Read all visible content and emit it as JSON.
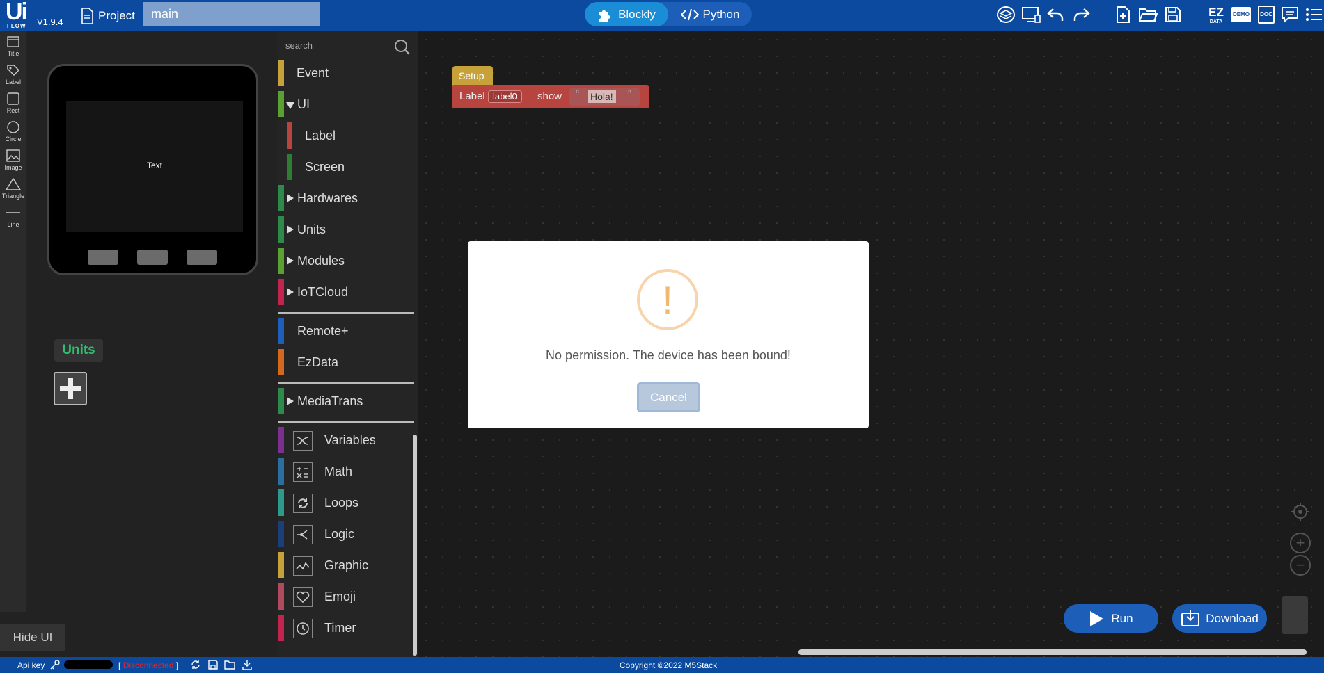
{
  "header": {
    "logo_main": "Ui",
    "logo_sub": "FLOW",
    "version": "V1.9.4",
    "project_label": "Project",
    "file_name": "main",
    "tabs": {
      "blockly": "Blockly",
      "python": "Python"
    },
    "ez_data": {
      "top": "EZ",
      "bottom": "DATA"
    },
    "demo": "DEMO",
    "doc": "DOC"
  },
  "tools": [
    {
      "label": "Title",
      "icon": "title-icon"
    },
    {
      "label": "Label",
      "icon": "label-icon"
    },
    {
      "label": "Rect",
      "icon": "rect-icon"
    },
    {
      "label": "Circle",
      "icon": "circle-icon"
    },
    {
      "label": "Image",
      "icon": "image-icon"
    },
    {
      "label": "Triangle",
      "icon": "triangle-icon"
    },
    {
      "label": "Line",
      "icon": "line-icon"
    }
  ],
  "device": {
    "screen_text": "Text"
  },
  "units_panel": {
    "title": "Units"
  },
  "hide_ui": "Hide UI",
  "categories": {
    "search_placeholder": "search",
    "items": [
      {
        "label": "Event",
        "color": "#c7a23a"
      },
      {
        "label": "UI",
        "color": "#5ba033"
      },
      {
        "label": "Label",
        "color": "#b8443f"
      },
      {
        "label": "Screen",
        "color": "#2e7d32"
      },
      {
        "label": "Hardwares",
        "color": "#2e8a4a"
      },
      {
        "label": "Units",
        "color": "#2e8a4a"
      },
      {
        "label": "Modules",
        "color": "#5ba033"
      },
      {
        "label": "IoTCloud",
        "color": "#c0244f"
      },
      {
        "label": "Remote+",
        "color": "#1d5fb8"
      },
      {
        "label": "EzData",
        "color": "#d2691e"
      },
      {
        "label": "MediaTrans",
        "color": "#2e8a4a"
      },
      {
        "label": "Variables",
        "color": "#7b2f8e"
      },
      {
        "label": "Math",
        "color": "#2a6fa0"
      },
      {
        "label": "Loops",
        "color": "#2e9a8a"
      },
      {
        "label": "Logic",
        "color": "#1c3f7a"
      },
      {
        "label": "Graphic",
        "color": "#c7a23a"
      },
      {
        "label": "Emoji",
        "color": "#b04a5e"
      },
      {
        "label": "Timer",
        "color": "#c0244f"
      }
    ]
  },
  "workspace": {
    "setup": "Setup",
    "block": {
      "text1": "Label",
      "field": "label0",
      "text2": "show",
      "value": "Hola!"
    }
  },
  "actions": {
    "run": "Run",
    "download": "Download"
  },
  "dialog": {
    "icon": "!",
    "message": "No permission. The device has been bound!",
    "cancel": "Cancel"
  },
  "status": {
    "api_key_label": "Api key",
    "bracket_open": "[",
    "connection": "Disconnected",
    "bracket_close": "]",
    "copyright": "Copyright ©2022 M5Stack"
  },
  "colors": {
    "accent": "#0b4a9e",
    "warn": "#f2b872"
  }
}
